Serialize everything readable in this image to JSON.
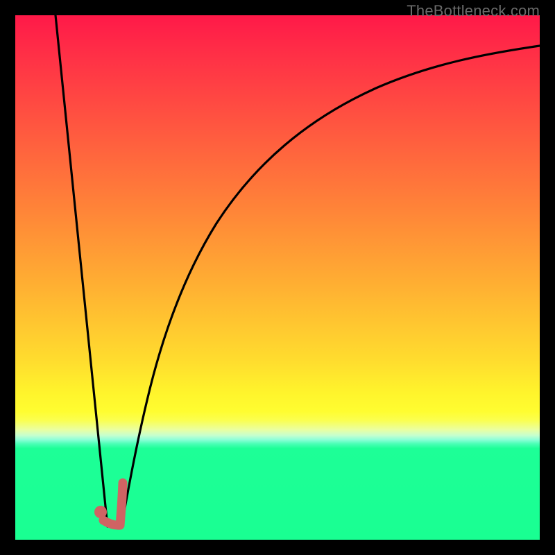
{
  "watermark": "TheBottleneck.com",
  "chart_data": {
    "type": "line",
    "title": "",
    "xlabel": "",
    "ylabel": "",
    "xlim": [
      0,
      100
    ],
    "ylim": [
      0,
      100
    ],
    "grid": false,
    "legend": false,
    "background": "rainbow-gradient (red top to green bottom)",
    "series": [
      {
        "name": "left-linear-descent",
        "x": [
          7.7,
          17.6
        ],
        "y": [
          100,
          2.5
        ]
      },
      {
        "name": "right-curve-ascent",
        "x": [
          20.2,
          22,
          24,
          27,
          31,
          36,
          42,
          50,
          60,
          72,
          86,
          100
        ],
        "y": [
          2.5,
          10,
          20,
          32,
          45,
          57,
          67,
          76,
          83,
          88.5,
          92,
          94.2
        ]
      }
    ],
    "markers": [
      {
        "name": "valley-dot",
        "x": 16.3,
        "y": 5.3,
        "color": "#cf6363",
        "r": 1.2
      },
      {
        "name": "tick-shape-vertical-top",
        "x": 20.5,
        "y": 10.9
      },
      {
        "name": "tick-shape-vertical-bottom",
        "x": 20.0,
        "y": 2.8
      },
      {
        "name": "tick-shape-horizontal-end",
        "x": 16.8,
        "y": 3.8
      }
    ],
    "annotations": []
  }
}
